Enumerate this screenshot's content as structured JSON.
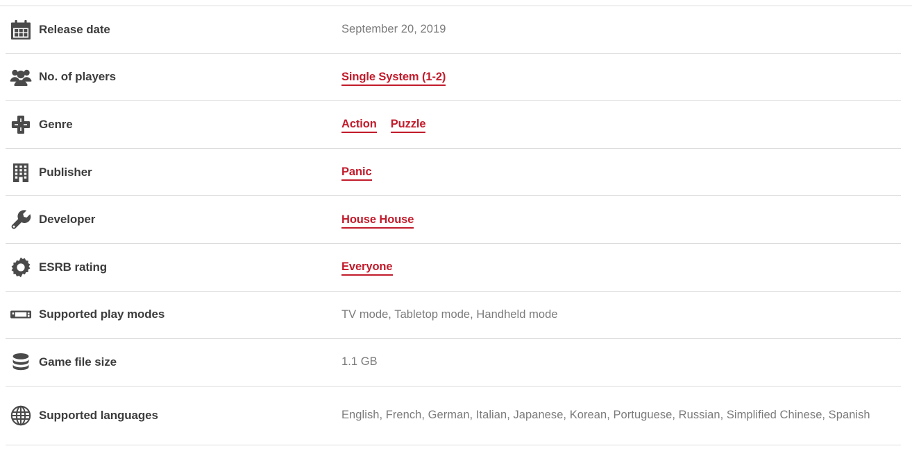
{
  "theme": {
    "link_color": "#c21b2b",
    "label_color": "#3c3c3c",
    "value_color": "#7b7b7b",
    "separator_color": "#dcdcdc",
    "icon_color": "#4a4a4a",
    "background": "#ffffff"
  },
  "rows": [
    {
      "icon": "calendar-icon",
      "label": "Release date",
      "value_type": "text",
      "value": "September 20, 2019"
    },
    {
      "icon": "players-group-icon",
      "label": "No. of players",
      "value_type": "links",
      "links": [
        "Single System (1-2)"
      ]
    },
    {
      "icon": "dpad-icon",
      "label": "Genre",
      "value_type": "links",
      "links": [
        "Action",
        "Puzzle"
      ]
    },
    {
      "icon": "building-icon",
      "label": "Publisher",
      "value_type": "links",
      "links": [
        "Panic"
      ]
    },
    {
      "icon": "wrench-icon",
      "label": "Developer",
      "value_type": "links",
      "links": [
        "House House"
      ]
    },
    {
      "icon": "gear-icon",
      "label": "ESRB rating",
      "value_type": "links",
      "links": [
        "Everyone"
      ]
    },
    {
      "icon": "handheld-console-icon",
      "label": "Supported play modes",
      "value_type": "text",
      "value": "TV mode, Tabletop mode, Handheld mode"
    },
    {
      "icon": "database-icon",
      "label": "Game file size",
      "value_type": "text",
      "value": "1.1 GB"
    },
    {
      "icon": "globe-icon",
      "label": "Supported languages",
      "value_type": "text",
      "value": "English, French, German, Italian, Japanese, Korean, Portuguese, Russian, Simplified Chinese, Spanish"
    }
  ]
}
